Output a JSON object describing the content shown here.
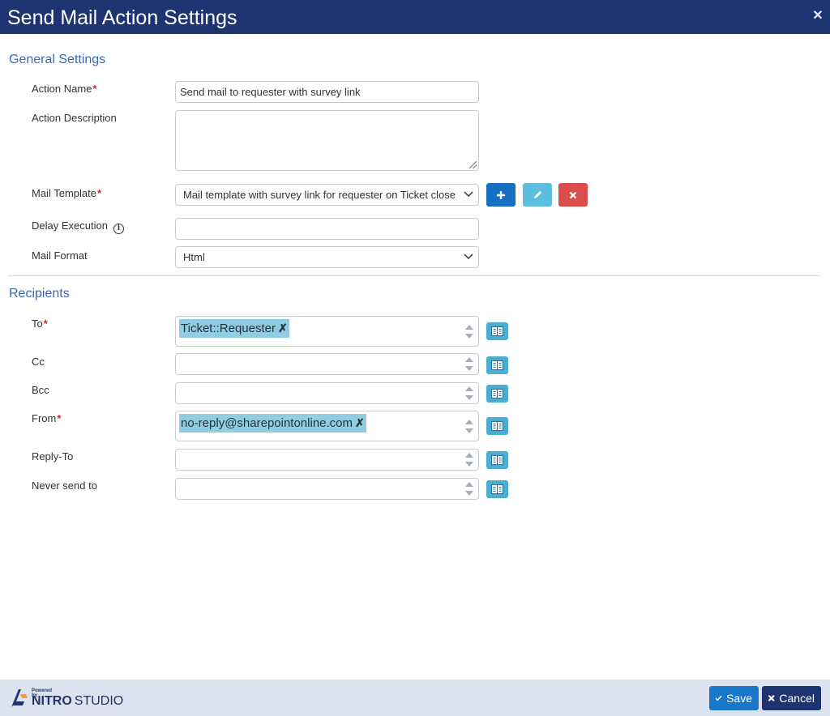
{
  "dialog": {
    "title": "Send Mail Action Settings"
  },
  "general": {
    "section_title": "General Settings",
    "action_name": {
      "label": "Action Name",
      "value": "Send mail to requester with survey link"
    },
    "action_description": {
      "label": "Action Description",
      "value": ""
    },
    "mail_template": {
      "label": "Mail Template",
      "value": "Mail template with survey link for requester on Ticket close"
    },
    "delay_execution": {
      "label": "Delay Execution",
      "value": ""
    },
    "mail_format": {
      "label": "Mail Format",
      "value": "Html"
    }
  },
  "recipients": {
    "section_title": "Recipients",
    "to": {
      "label": "To",
      "tags": [
        "Ticket::Requester"
      ]
    },
    "cc": {
      "label": "Cc"
    },
    "bcc": {
      "label": "Bcc"
    },
    "from": {
      "label": "From",
      "tags": [
        "no-reply@sharepointonline.com"
      ]
    },
    "reply_to": {
      "label": "Reply-To"
    },
    "never_send_to": {
      "label": "Never send to"
    }
  },
  "footer": {
    "brand_powered": "Powered by",
    "brand_name": "NITRO",
    "brand_studio": "STUDIO",
    "save_label": "Save",
    "cancel_label": "Cancel"
  },
  "icons": {
    "close": "close-icon",
    "info": "info-icon",
    "add": "plus-icon",
    "edit": "pencil-icon",
    "delete": "x-icon",
    "address_book": "address-book-icon",
    "save": "check-icon",
    "cancel": "x-icon"
  },
  "colors": {
    "titlebar": "#1d3470",
    "section_title": "#3a66b5",
    "required": "#d9232e",
    "tag_bg": "#90cde2",
    "add_btn": "#1671c5",
    "edit_btn": "#5bbfdd",
    "delete_btn": "#dc4e4b",
    "book_btn": "#4aaed3",
    "footer_bg": "#dce3ee",
    "save_btn": "#1877c9",
    "cancel_btn": "#1d3470"
  }
}
